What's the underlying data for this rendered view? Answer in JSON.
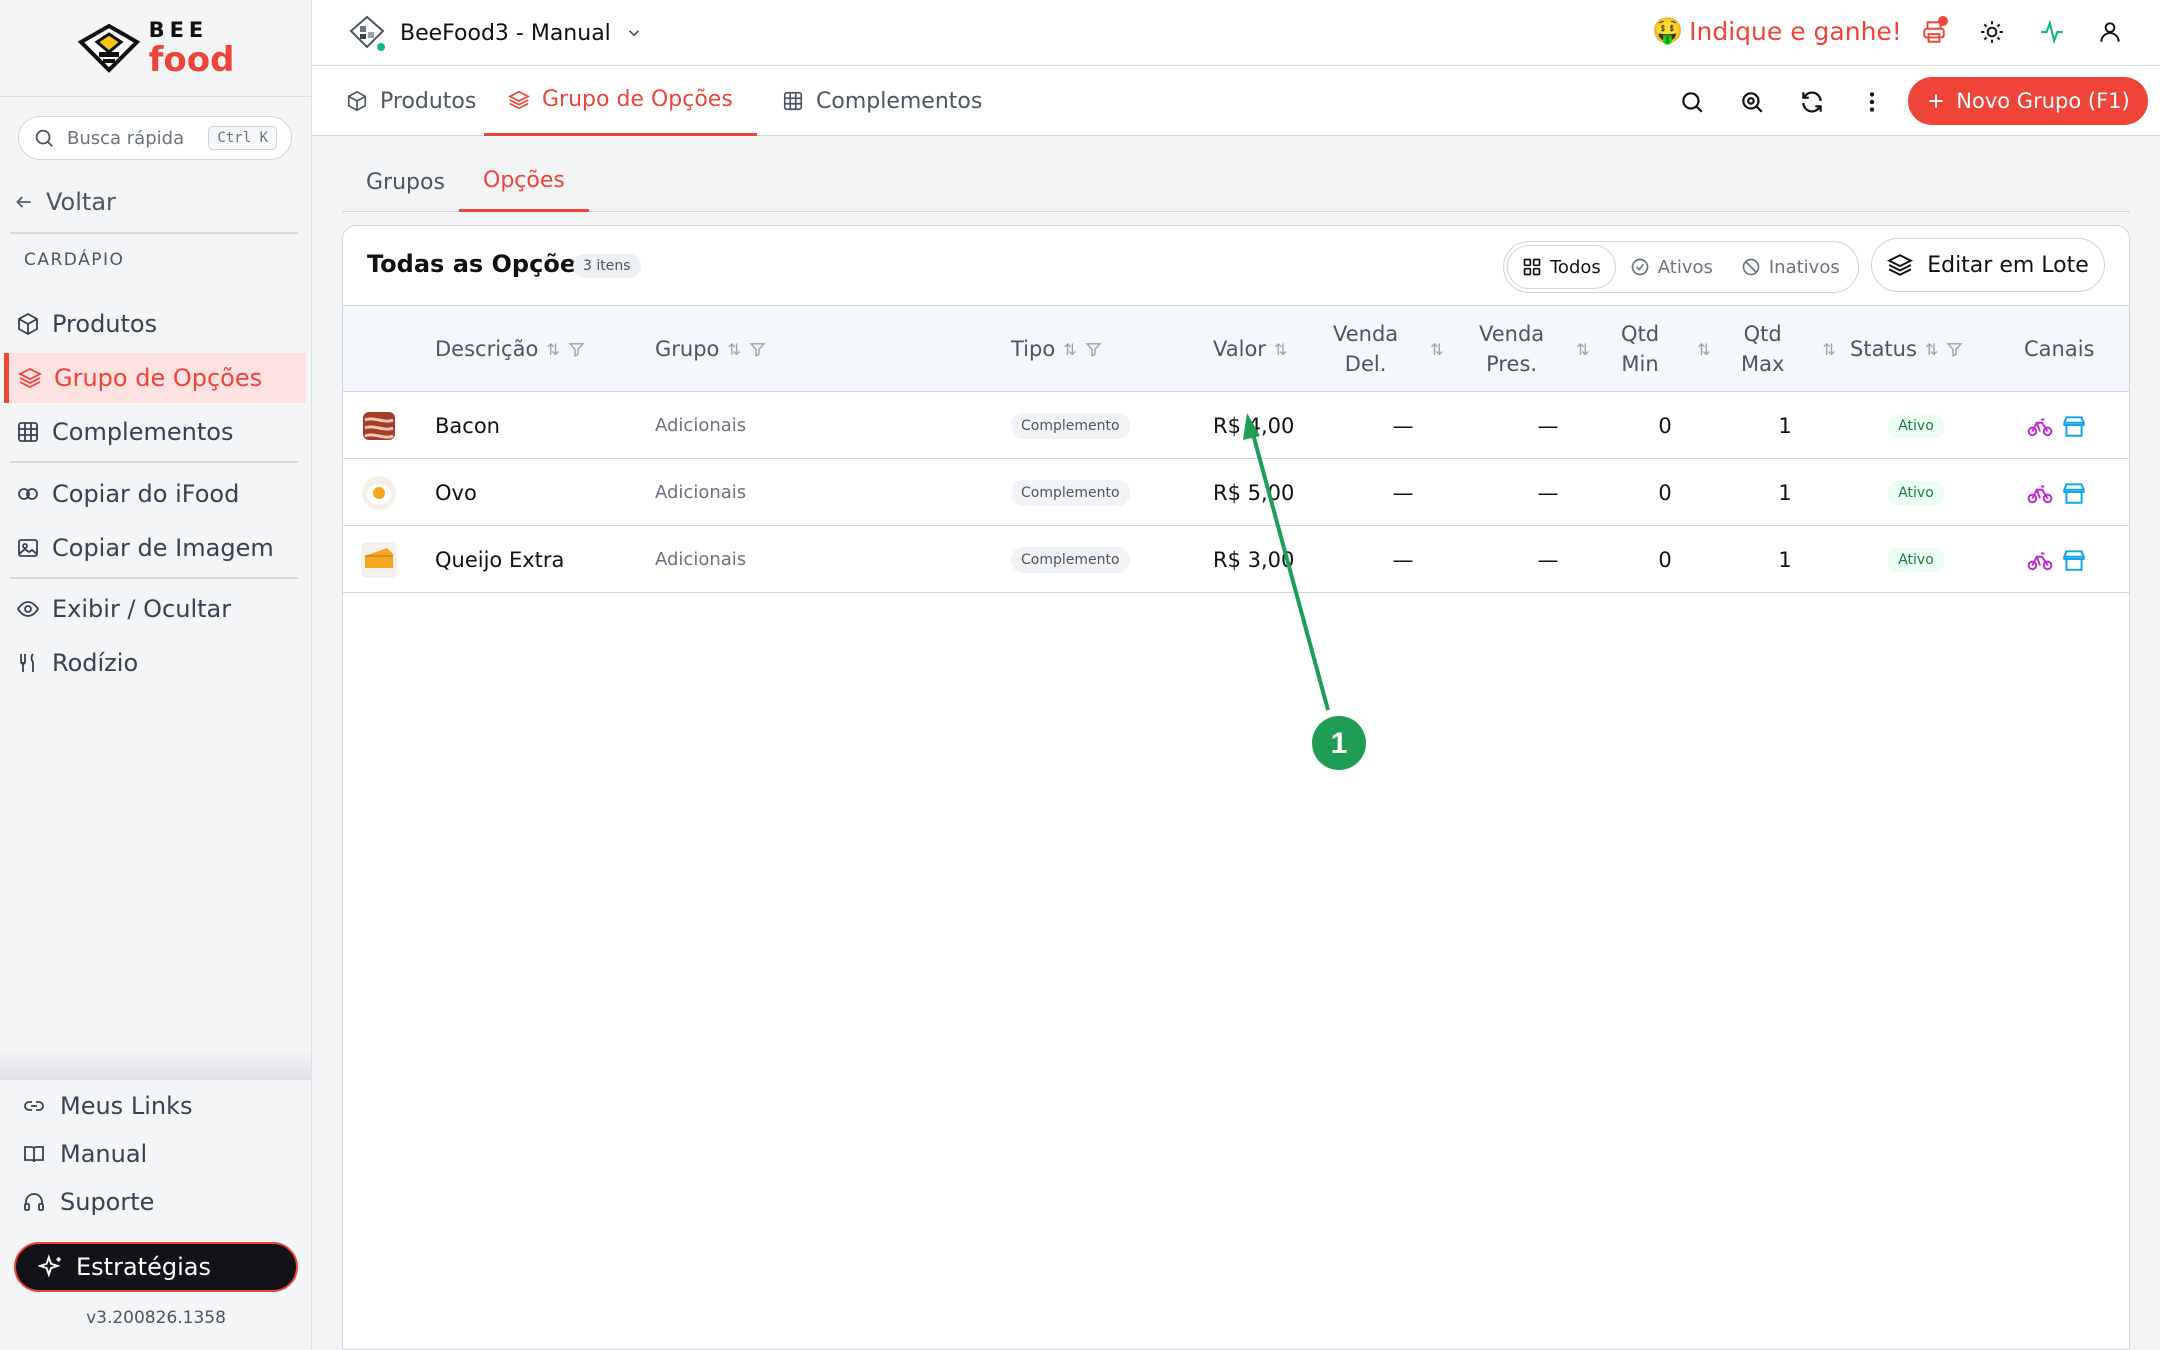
{
  "sidebar": {
    "logo": {
      "top": "BEE",
      "bottom": "food"
    },
    "search": {
      "placeholder": "Busca rápida",
      "shortcut": "Ctrl K"
    },
    "back_label": "Voltar",
    "section_label": "CARDÁPIO",
    "items": [
      {
        "label": "Produtos",
        "icon": "box-icon"
      },
      {
        "label": "Grupo de Opções",
        "icon": "layers-icon",
        "active": true
      },
      {
        "label": "Complementos",
        "icon": "grid-icon"
      },
      {
        "label": "Copiar do iFood",
        "icon": "copy-icon"
      },
      {
        "label": "Copiar de Imagem",
        "icon": "image-icon"
      },
      {
        "label": "Exibir / Ocultar",
        "icon": "eye-icon"
      },
      {
        "label": "Rodízio",
        "icon": "utensils-icon"
      }
    ],
    "bottom": [
      {
        "label": "Meus Links",
        "icon": "link-icon"
      },
      {
        "label": "Manual",
        "icon": "book-icon"
      },
      {
        "label": "Suporte",
        "icon": "headset-icon"
      }
    ],
    "strategies_label": "Estratégias",
    "version": "v3.200826.1358"
  },
  "topbar": {
    "store_name": "BeeFood3 - Manual",
    "promo_emoji": "🤑",
    "promo_text": "Indique e ganhe!"
  },
  "tabs": [
    {
      "label": "Produtos",
      "icon": "box-icon"
    },
    {
      "label": "Grupo de Opções",
      "icon": "layers-icon",
      "active": true
    },
    {
      "label": "Complementos",
      "icon": "grid-icon"
    }
  ],
  "new_group_label": "Novo Grupo (F1)",
  "subtabs": [
    {
      "label": "Grupos"
    },
    {
      "label": "Opções",
      "active": true
    }
  ],
  "card": {
    "title": "Todas as Opções",
    "count": "3 itens",
    "filters": [
      {
        "label": "Todos",
        "active": true
      },
      {
        "label": "Ativos"
      },
      {
        "label": "Inativos"
      }
    ],
    "batch_edit_label": "Editar em Lote"
  },
  "table": {
    "columns": {
      "descricao": "Descrição",
      "grupo": "Grupo",
      "tipo": "Tipo",
      "valor": "Valor",
      "venda_del_1": "Venda",
      "venda_del_2": "Del.",
      "venda_pres_1": "Venda",
      "venda_pres_2": "Pres.",
      "qtd_min_1": "Qtd",
      "qtd_min_2": "Min",
      "qtd_max_1": "Qtd",
      "qtd_max_2": "Max",
      "status": "Status",
      "canais": "Canais"
    },
    "rows": [
      {
        "descricao": "Bacon",
        "grupo": "Adicionais",
        "tipo": "Complemento",
        "valor": "R$ 4,00",
        "venda_del": "—",
        "venda_pres": "—",
        "qtd_min": "0",
        "qtd_max": "1",
        "status": "Ativo"
      },
      {
        "descricao": "Ovo",
        "grupo": "Adicionais",
        "tipo": "Complemento",
        "valor": "R$ 5,00",
        "venda_del": "—",
        "venda_pres": "—",
        "qtd_min": "0",
        "qtd_max": "1",
        "status": "Ativo"
      },
      {
        "descricao": "Queijo Extra",
        "grupo": "Adicionais",
        "tipo": "Complemento",
        "valor": "R$ 3,00",
        "venda_del": "—",
        "venda_pres": "—",
        "qtd_min": "0",
        "qtd_max": "1",
        "status": "Ativo"
      }
    ]
  },
  "annotation": {
    "label": "1",
    "color": "#1f9d55"
  },
  "colors": {
    "accent": "#ef4438",
    "success": "#15803d",
    "delivery": "#c026d3",
    "store": "#0ea5e9"
  }
}
